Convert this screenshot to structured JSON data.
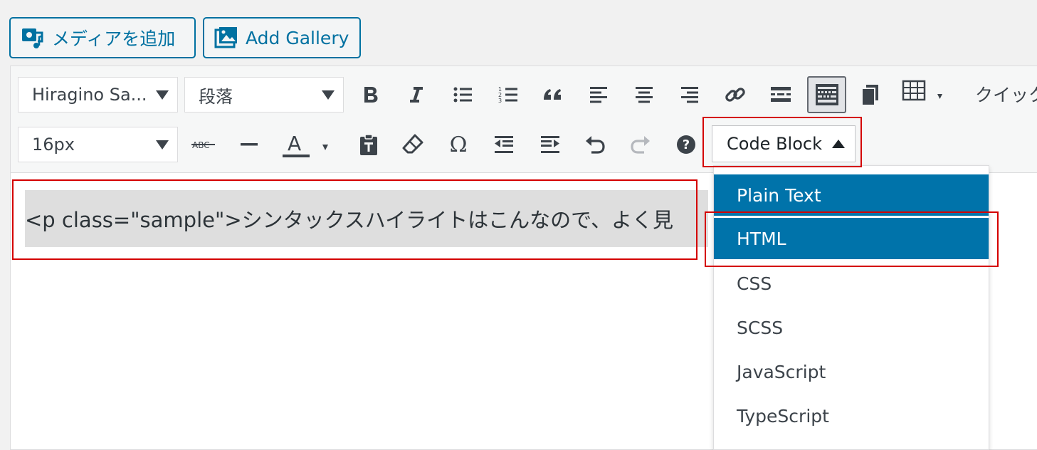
{
  "media_buttons": {
    "add_media": "メディアを追加",
    "add_gallery": "Add Gallery"
  },
  "toolbar": {
    "font_family": "Hiragino Sa...",
    "block_format": "段落",
    "font_size": "16px",
    "more_label": "クイック",
    "code_block_label": "Code Block",
    "icons_row1": [
      "bold-icon",
      "italic-icon",
      "bullet-list-icon",
      "numbered-list-icon",
      "blockquote-icon",
      "align-left-icon",
      "align-center-icon",
      "align-right-icon",
      "link-icon",
      "read-more-icon",
      "toolbar-toggle-icon",
      "copy-icon",
      "table-icon"
    ],
    "icons_row2": [
      "strikethrough-icon",
      "horizontal-line-icon",
      "text-color-icon",
      "paste-text-icon",
      "clear-formatting-icon",
      "special-character-icon",
      "outdent-icon",
      "indent-icon",
      "undo-icon",
      "redo-icon",
      "help-icon"
    ]
  },
  "editor": {
    "content": "<p class=\"sample\">シンタックスハイライトはこんなので、よく見"
  },
  "dropdown": {
    "items": [
      {
        "label": "Plain Text",
        "selected": true
      },
      {
        "label": "HTML",
        "selected": true
      },
      {
        "label": "CSS",
        "selected": false
      },
      {
        "label": "SCSS",
        "selected": false
      },
      {
        "label": "JavaScript",
        "selected": false
      },
      {
        "label": "TypeScript",
        "selected": false
      }
    ]
  },
  "colors": {
    "accent": "#0073aa",
    "highlight_box": "#d40000",
    "code_bg": "#dedede"
  }
}
